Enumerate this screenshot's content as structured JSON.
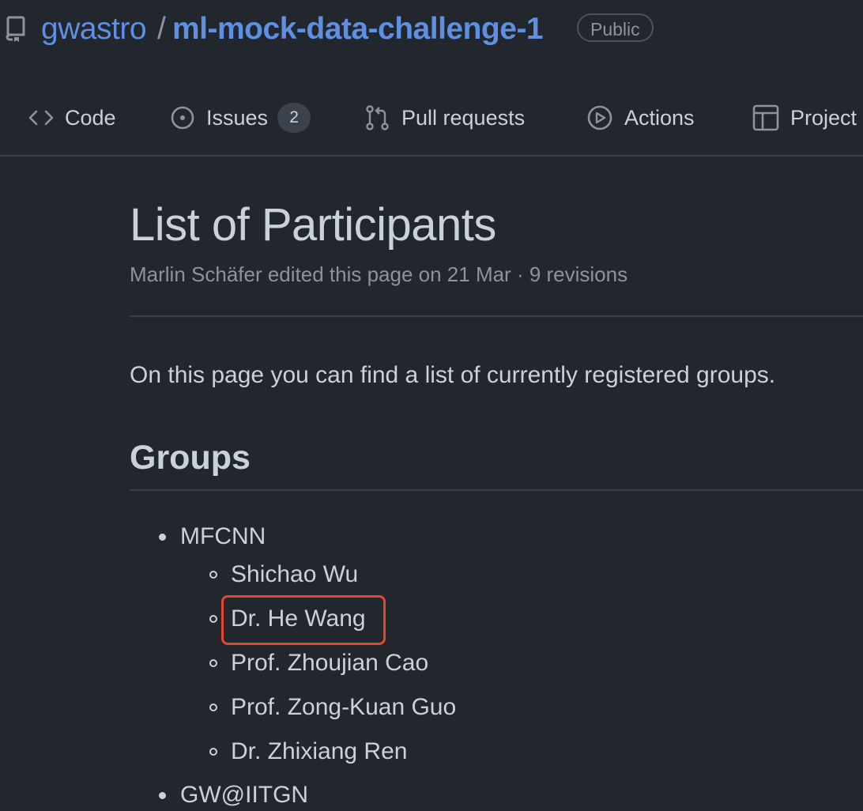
{
  "header": {
    "owner": "gwastro",
    "separator": "/",
    "repo": "ml-mock-data-challenge-1",
    "visibility_badge": "Public",
    "repo_icon": "repo-icon"
  },
  "nav": {
    "tabs": [
      {
        "label": "Code",
        "icon": "code-icon"
      },
      {
        "label": "Issues",
        "icon": "issue-opened-icon",
        "count": "2"
      },
      {
        "label": "Pull requests",
        "icon": "git-pull-request-icon"
      },
      {
        "label": "Actions",
        "icon": "play-icon"
      },
      {
        "label": "Project",
        "icon": "table-icon"
      }
    ]
  },
  "page": {
    "title": "List of Participants",
    "meta": "Marlin Schäfer edited this page on 21 Mar · 9 revisions",
    "intro": "On this page you can find a list of currently registered groups.",
    "groups_heading": "Groups",
    "groups": [
      {
        "name": "MFCNN",
        "members": [
          "Shichao Wu",
          "Dr. He Wang",
          "Prof. Zhoujian Cao",
          "Prof. Zong-Kuan Guo",
          "Dr. Zhixiang Ren"
        ]
      },
      {
        "name": "GW@IITGN",
        "members": []
      }
    ],
    "highlight_color": "#e5462c"
  }
}
